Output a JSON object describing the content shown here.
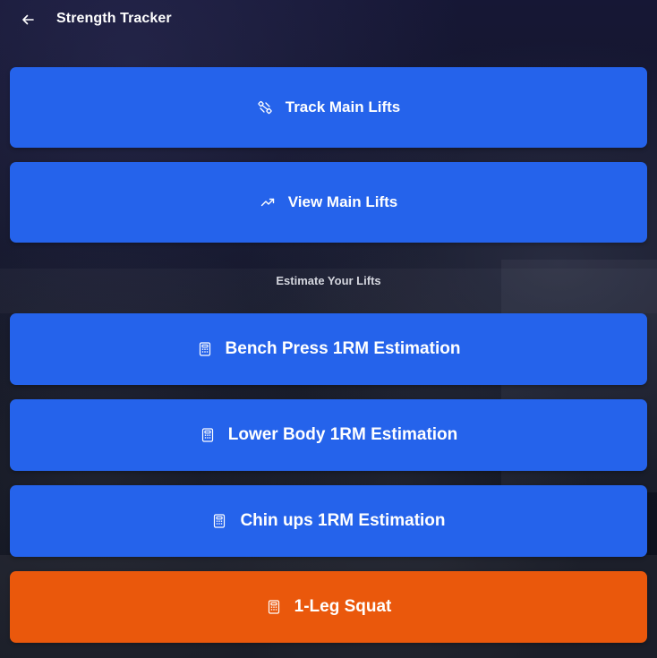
{
  "header": {
    "title": "Strength Tracker"
  },
  "actions": {
    "track_main_lifts": "Track Main Lifts",
    "view_main_lifts": "View Main Lifts"
  },
  "estimate_section": {
    "heading": "Estimate Your Lifts",
    "bench_press": "Bench Press 1RM Estimation",
    "lower_body": "Lower Body 1RM Estimation",
    "chin_ups": "Chin ups 1RM Estimation",
    "one_leg_squat": "1-Leg Squat"
  },
  "colors": {
    "primary_button": "#2563eb",
    "accent_button": "#ea580c",
    "background": "#0f1322"
  },
  "icons": {
    "back": "arrow-left-icon",
    "track": "dumbbell-icon",
    "view": "trending-up-icon",
    "calculator": "calculator-icon"
  }
}
